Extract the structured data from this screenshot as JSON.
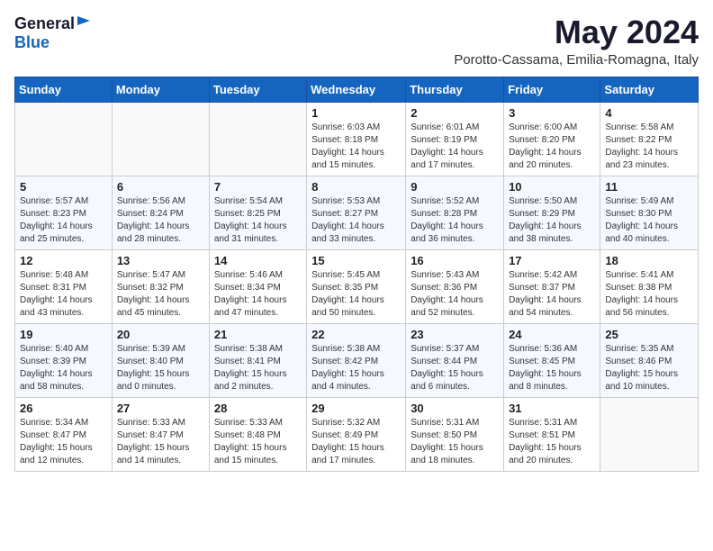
{
  "header": {
    "logo_general": "General",
    "logo_blue": "Blue",
    "month": "May 2024",
    "location": "Porotto-Cassama, Emilia-Romagna, Italy"
  },
  "weekdays": [
    "Sunday",
    "Monday",
    "Tuesday",
    "Wednesday",
    "Thursday",
    "Friday",
    "Saturday"
  ],
  "weeks": [
    [
      {
        "day": "",
        "info": ""
      },
      {
        "day": "",
        "info": ""
      },
      {
        "day": "",
        "info": ""
      },
      {
        "day": "1",
        "info": "Sunrise: 6:03 AM\nSunset: 8:18 PM\nDaylight: 14 hours\nand 15 minutes."
      },
      {
        "day": "2",
        "info": "Sunrise: 6:01 AM\nSunset: 8:19 PM\nDaylight: 14 hours\nand 17 minutes."
      },
      {
        "day": "3",
        "info": "Sunrise: 6:00 AM\nSunset: 8:20 PM\nDaylight: 14 hours\nand 20 minutes."
      },
      {
        "day": "4",
        "info": "Sunrise: 5:58 AM\nSunset: 8:22 PM\nDaylight: 14 hours\nand 23 minutes."
      }
    ],
    [
      {
        "day": "5",
        "info": "Sunrise: 5:57 AM\nSunset: 8:23 PM\nDaylight: 14 hours\nand 25 minutes."
      },
      {
        "day": "6",
        "info": "Sunrise: 5:56 AM\nSunset: 8:24 PM\nDaylight: 14 hours\nand 28 minutes."
      },
      {
        "day": "7",
        "info": "Sunrise: 5:54 AM\nSunset: 8:25 PM\nDaylight: 14 hours\nand 31 minutes."
      },
      {
        "day": "8",
        "info": "Sunrise: 5:53 AM\nSunset: 8:27 PM\nDaylight: 14 hours\nand 33 minutes."
      },
      {
        "day": "9",
        "info": "Sunrise: 5:52 AM\nSunset: 8:28 PM\nDaylight: 14 hours\nand 36 minutes."
      },
      {
        "day": "10",
        "info": "Sunrise: 5:50 AM\nSunset: 8:29 PM\nDaylight: 14 hours\nand 38 minutes."
      },
      {
        "day": "11",
        "info": "Sunrise: 5:49 AM\nSunset: 8:30 PM\nDaylight: 14 hours\nand 40 minutes."
      }
    ],
    [
      {
        "day": "12",
        "info": "Sunrise: 5:48 AM\nSunset: 8:31 PM\nDaylight: 14 hours\nand 43 minutes."
      },
      {
        "day": "13",
        "info": "Sunrise: 5:47 AM\nSunset: 8:32 PM\nDaylight: 14 hours\nand 45 minutes."
      },
      {
        "day": "14",
        "info": "Sunrise: 5:46 AM\nSunset: 8:34 PM\nDaylight: 14 hours\nand 47 minutes."
      },
      {
        "day": "15",
        "info": "Sunrise: 5:45 AM\nSunset: 8:35 PM\nDaylight: 14 hours\nand 50 minutes."
      },
      {
        "day": "16",
        "info": "Sunrise: 5:43 AM\nSunset: 8:36 PM\nDaylight: 14 hours\nand 52 minutes."
      },
      {
        "day": "17",
        "info": "Sunrise: 5:42 AM\nSunset: 8:37 PM\nDaylight: 14 hours\nand 54 minutes."
      },
      {
        "day": "18",
        "info": "Sunrise: 5:41 AM\nSunset: 8:38 PM\nDaylight: 14 hours\nand 56 minutes."
      }
    ],
    [
      {
        "day": "19",
        "info": "Sunrise: 5:40 AM\nSunset: 8:39 PM\nDaylight: 14 hours\nand 58 minutes."
      },
      {
        "day": "20",
        "info": "Sunrise: 5:39 AM\nSunset: 8:40 PM\nDaylight: 15 hours\nand 0 minutes."
      },
      {
        "day": "21",
        "info": "Sunrise: 5:38 AM\nSunset: 8:41 PM\nDaylight: 15 hours\nand 2 minutes."
      },
      {
        "day": "22",
        "info": "Sunrise: 5:38 AM\nSunset: 8:42 PM\nDaylight: 15 hours\nand 4 minutes."
      },
      {
        "day": "23",
        "info": "Sunrise: 5:37 AM\nSunset: 8:44 PM\nDaylight: 15 hours\nand 6 minutes."
      },
      {
        "day": "24",
        "info": "Sunrise: 5:36 AM\nSunset: 8:45 PM\nDaylight: 15 hours\nand 8 minutes."
      },
      {
        "day": "25",
        "info": "Sunrise: 5:35 AM\nSunset: 8:46 PM\nDaylight: 15 hours\nand 10 minutes."
      }
    ],
    [
      {
        "day": "26",
        "info": "Sunrise: 5:34 AM\nSunset: 8:47 PM\nDaylight: 15 hours\nand 12 minutes."
      },
      {
        "day": "27",
        "info": "Sunrise: 5:33 AM\nSunset: 8:47 PM\nDaylight: 15 hours\nand 14 minutes."
      },
      {
        "day": "28",
        "info": "Sunrise: 5:33 AM\nSunset: 8:48 PM\nDaylight: 15 hours\nand 15 minutes."
      },
      {
        "day": "29",
        "info": "Sunrise: 5:32 AM\nSunset: 8:49 PM\nDaylight: 15 hours\nand 17 minutes."
      },
      {
        "day": "30",
        "info": "Sunrise: 5:31 AM\nSunset: 8:50 PM\nDaylight: 15 hours\nand 18 minutes."
      },
      {
        "day": "31",
        "info": "Sunrise: 5:31 AM\nSunset: 8:51 PM\nDaylight: 15 hours\nand 20 minutes."
      },
      {
        "day": "",
        "info": ""
      }
    ]
  ]
}
